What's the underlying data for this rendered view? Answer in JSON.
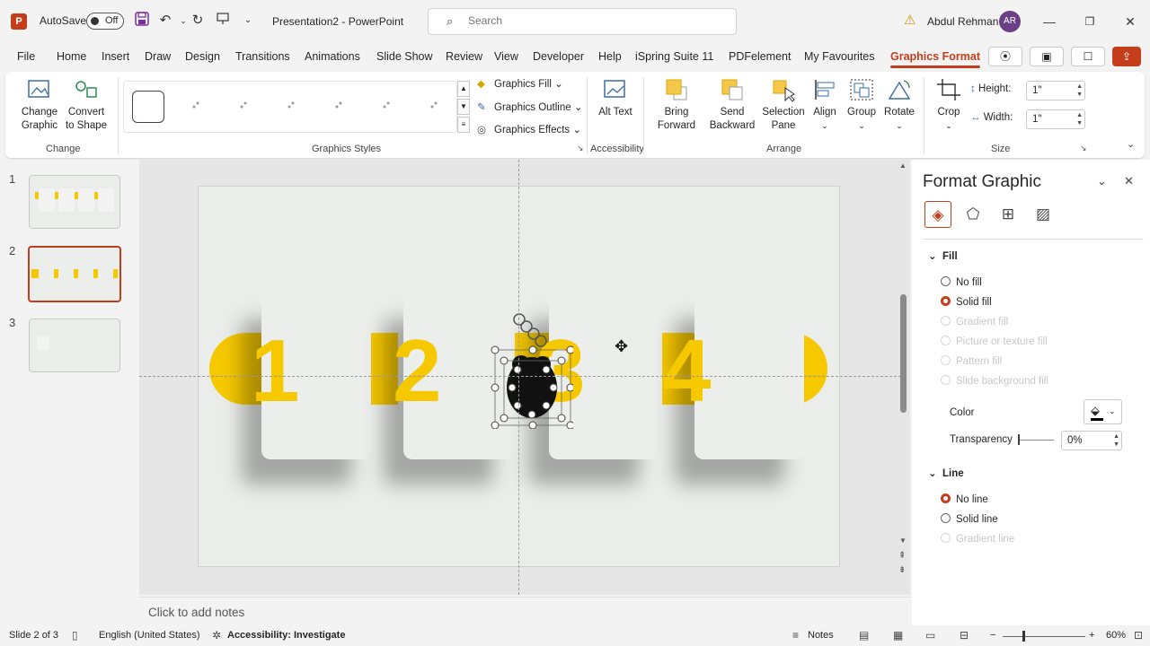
{
  "titlebar": {
    "autosave_label": "AutoSave",
    "autosave_state": "Off",
    "doc_title": "Presentation2  -  PowerPoint",
    "search_placeholder": "Search",
    "user_name": "Abdul Rehman",
    "avatar_initials": "AR"
  },
  "menu": {
    "tabs": [
      "File",
      "Home",
      "Insert",
      "Draw",
      "Design",
      "Transitions",
      "Animations",
      "Slide Show",
      "Review",
      "View",
      "Developer",
      "Help",
      "iSpring Suite 11",
      "PDFelement",
      "My Favourites",
      "Graphics Format"
    ],
    "active_tab": "Graphics Format"
  },
  "ribbon": {
    "change_graphic": "Change Graphic",
    "convert_shape": "Convert to Shape",
    "change_group": "Change",
    "graphics_fill": "Graphics Fill",
    "graphics_outline": "Graphics Outline",
    "graphics_effects": "Graphics Effects",
    "styles_group": "Graphics Styles",
    "alt_text": "Alt Text",
    "accessibility_group": "Accessibility",
    "bring_forward": "Bring Forward",
    "send_backward": "Send Backward",
    "selection_pane": "Selection Pane",
    "align": "Align",
    "group": "Group",
    "rotate": "Rotate",
    "arrange_group": "Arrange",
    "crop": "Crop",
    "height_label": "Height:",
    "height_value": "1\"",
    "width_label": "Width:",
    "width_value": "1\"",
    "size_group": "Size"
  },
  "slides": {
    "numbers": [
      "1",
      "2",
      "3"
    ],
    "selected": 2
  },
  "slide": {
    "numbers": [
      "1",
      "2",
      "3",
      "4"
    ]
  },
  "notes_placeholder": "Click to add notes",
  "format_pane": {
    "title": "Format Graphic",
    "fill_header": "Fill",
    "fill_options": [
      "No fill",
      "Solid fill",
      "Gradient fill",
      "Picture or texture fill",
      "Pattern fill",
      "Slide background fill"
    ],
    "color_label": "Color",
    "transparency_label": "Transparency",
    "transparency_value": "0%",
    "line_header": "Line",
    "line_options": [
      "No line",
      "Solid line",
      "Gradient line"
    ]
  },
  "status": {
    "slide_info": "Slide 2 of 3",
    "language": "English (United States)",
    "accessibility": "Accessibility: Investigate",
    "notes": "Notes",
    "zoom": "60%"
  },
  "colors": {
    "accent": "#c43e1c",
    "yellow": "#f5c800"
  }
}
